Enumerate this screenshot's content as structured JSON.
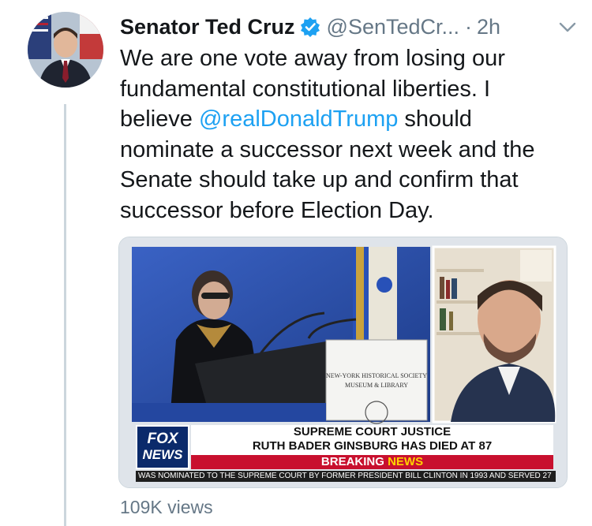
{
  "tweet": {
    "display_name": "Senator Ted Cruz",
    "handle": "@SenTedCr...",
    "separator": "·",
    "time": "2h",
    "text_before": "We are one vote away from losing our fundamental constitutional liberties. I believe",
    "lines": [
      "We are one vote away from losing our",
      "fundamental constitutional liberties. I",
      "believe ",
      "nominate a successor next week and the",
      "Senate should take up and confirm that",
      "successor before Election Day."
    ],
    "mention": "@realDonaldTrump",
    "after_mention": " should",
    "views": "109K views"
  },
  "media": {
    "podium_sign_line1": "NEW-YORK HISTORICAL SOCIETY",
    "podium_sign_line2": "MUSEUM & LIBRARY",
    "fox_logo_line1": "FOX",
    "fox_logo_line2": "NEWS",
    "headline_line1": "SUPREME COURT JUSTICE",
    "headline_line2": "RUTH BADER GINSBURG HAS DIED AT 87",
    "breaking_word": "BREAKING",
    "news_word": "NEWS",
    "ticker": "WAS NOMINATED TO THE SUPREME COURT BY FORMER PRESIDENT BILL CLINTON IN 1993 AND SERVED 27"
  },
  "icons": {
    "verified": "verified-badge-icon",
    "chevron": "chevron-down-icon",
    "avatar": "avatar"
  },
  "colors": {
    "link": "#1da1f2",
    "secondary_text": "#657786",
    "fox_red": "#c8102e",
    "fox_blue": "#0b2a6b"
  }
}
